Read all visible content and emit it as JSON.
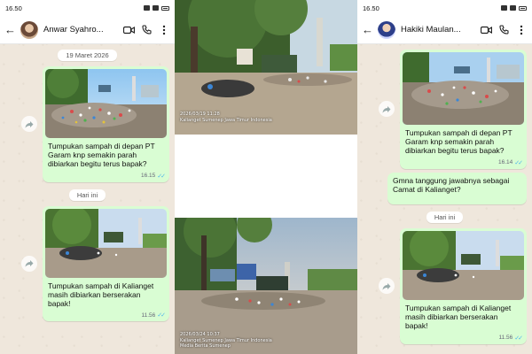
{
  "colors": {
    "bubble_out": "#d9fdd3",
    "tick_blue": "#4fb6ec",
    "chat_bg": "#efe7dc"
  },
  "left_phone": {
    "status_time": "16.50",
    "contact_name": "Anwar Syahro...",
    "icons": [
      "back-arrow-icon",
      "video-call-icon",
      "phone-icon",
      "more-vert-icon"
    ],
    "date_chip_1": "19 Maret 2026",
    "msg1_caption": "Tumpukan sampah di depan PT Garam knp semakin parah dibiarkan begitu terus bapak?",
    "msg1_time": "16.15",
    "date_chip_2": "Hari ini",
    "msg2_caption": "Tumpukan sampah di Kalianget masih dibiarkan berserakan bapak!",
    "msg2_time": "11.56"
  },
  "right_phone": {
    "status_time": "16.50",
    "contact_name": "Hakiki Maulan...",
    "icons": [
      "back-arrow-icon",
      "video-call-icon",
      "phone-icon",
      "more-vert-icon"
    ],
    "msg1_caption": "Tumpukan sampah di depan PT Garam knp semakin parah dibiarkan begitu terus bapak?",
    "msg1_time": "16.14",
    "msg2_text": "Gmna tanggung jawabnya sebagai Camat di Kalianget?",
    "date_chip_2": "Hari ini",
    "msg3_caption": "Tumpukan sampah di Kalianget masih dibiarkan berserakan bapak!",
    "msg3_time": "11.56"
  },
  "photos": {
    "top_stamp_line1": "2026/03/19 11:28",
    "top_stamp_line2": "Kalianget Sumenep Jawa Timur Indonesia",
    "bottom_stamp_line1": "2026/03/24 10:37",
    "bottom_stamp_line2": "Kalianget Sumenep Jawa Timur Indonesia",
    "bottom_stamp_line3": "Media Berita Sumenep"
  }
}
